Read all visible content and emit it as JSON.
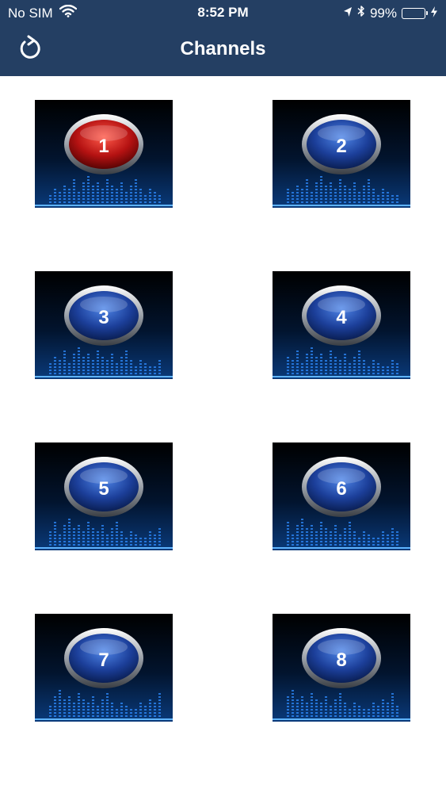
{
  "status_bar": {
    "carrier": "No SIM",
    "time": "8:52 PM",
    "battery_percent": "99%",
    "icons": [
      "wifi-icon",
      "location-arrow-icon",
      "bluetooth-icon",
      "battery-icon",
      "charging-bolt-icon"
    ],
    "battery_color": "#4cd964"
  },
  "nav": {
    "title": "Channels",
    "refresh_icon": "refresh-icon",
    "background": "#243f63"
  },
  "channels": [
    {
      "label": "1",
      "selected": true
    },
    {
      "label": "2",
      "selected": false
    },
    {
      "label": "3",
      "selected": false
    },
    {
      "label": "4",
      "selected": false
    },
    {
      "label": "5",
      "selected": false
    },
    {
      "label": "6",
      "selected": false
    },
    {
      "label": "7",
      "selected": false
    },
    {
      "label": "8",
      "selected": false
    }
  ],
  "colors": {
    "selected_button": "#b51212",
    "normal_button": "#1c3f9a",
    "equalizer_glow": "#2f8cff"
  }
}
